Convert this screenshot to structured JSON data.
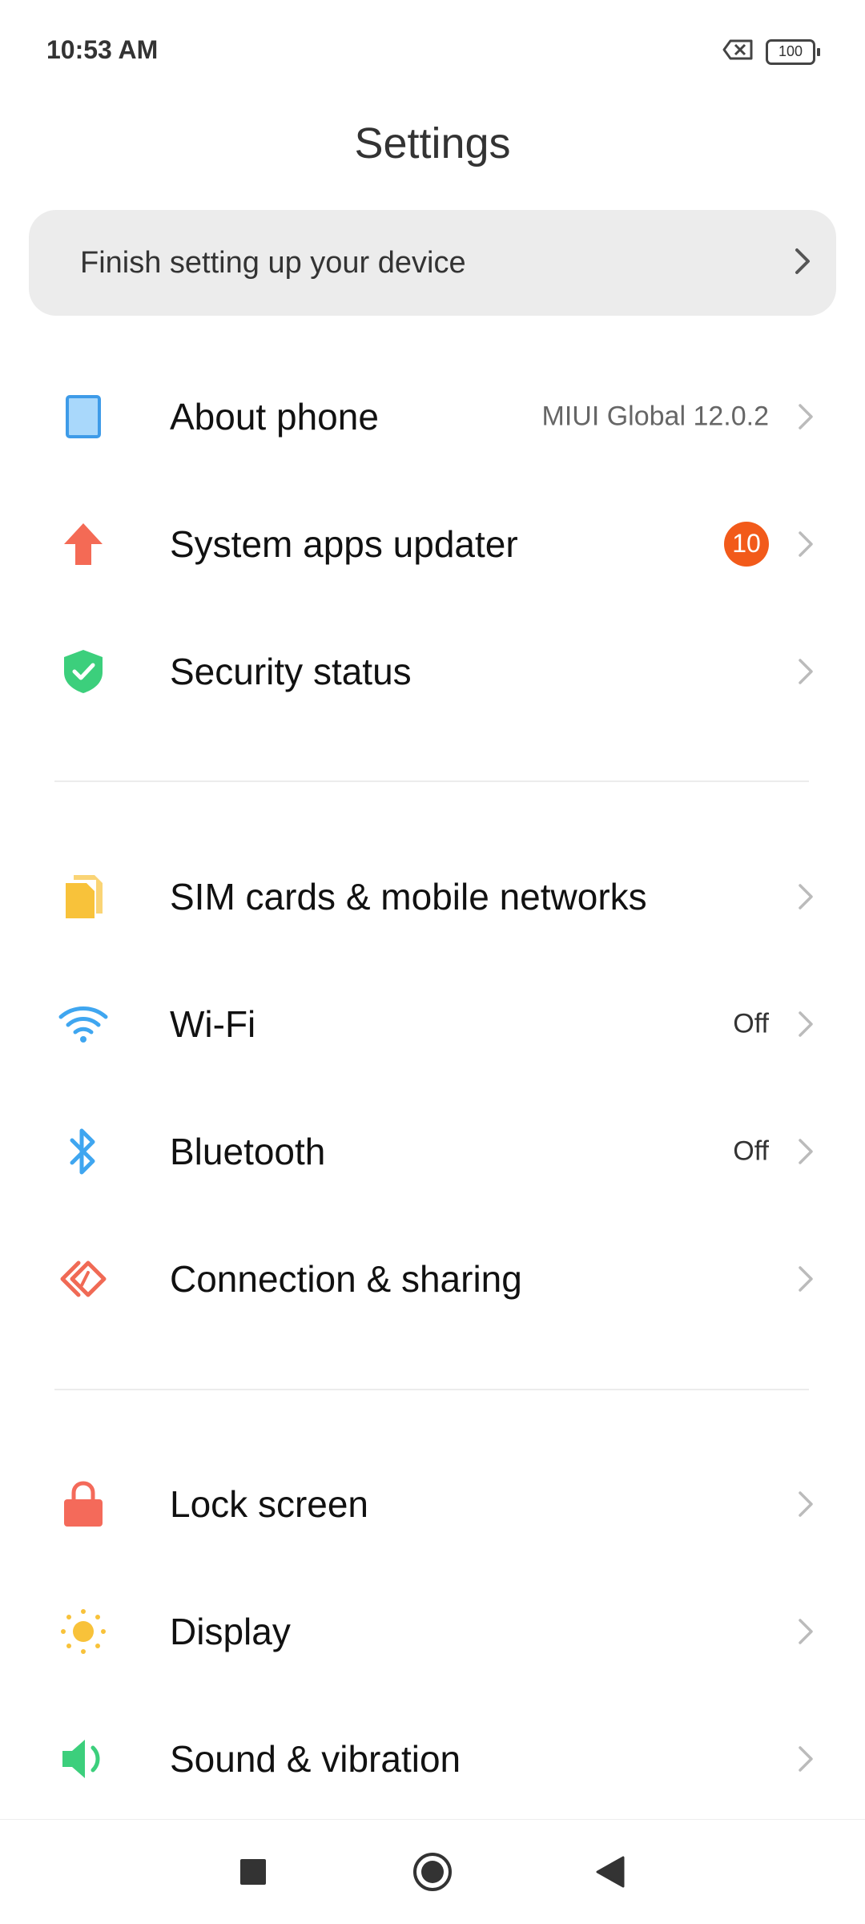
{
  "status_bar": {
    "time": "10:53 AM",
    "battery": "100"
  },
  "header": {
    "title": "Settings"
  },
  "setup_card": {
    "label": "Finish setting up your device"
  },
  "section1": {
    "about": {
      "label": "About phone",
      "value": "MIUI Global 12.0.2",
      "icon": "phone-icon"
    },
    "updater": {
      "label": "System apps updater",
      "badge": "10",
      "icon": "arrow-up-icon"
    },
    "security": {
      "label": "Security status",
      "icon": "shield-icon"
    }
  },
  "section2": {
    "sim": {
      "label": "SIM cards & mobile networks",
      "icon": "sim-icon"
    },
    "wifi": {
      "label": "Wi-Fi",
      "value": "Off",
      "icon": "wifi-icon"
    },
    "bluetooth": {
      "label": "Bluetooth",
      "value": "Off",
      "icon": "bluetooth-icon"
    },
    "connection": {
      "label": "Connection & sharing",
      "icon": "connection-icon"
    }
  },
  "section3": {
    "lock": {
      "label": "Lock screen",
      "icon": "lock-icon"
    },
    "display": {
      "label": "Display",
      "icon": "sun-icon"
    },
    "sound": {
      "label": "Sound & vibration",
      "icon": "speaker-icon"
    }
  },
  "colors": {
    "badge": "#f25a1a",
    "phone_icon": "#4aa3f0",
    "updater_icon": "#f46a55",
    "security_icon": "#3ccf7c",
    "sim_icon": "#f8c23a",
    "wifi_icon": "#3fa6f0",
    "connection_icon": "#f06a55",
    "lock_icon": "#f46a5a",
    "display_icon": "#f8c23a",
    "sound_icon": "#3ccf7c"
  }
}
